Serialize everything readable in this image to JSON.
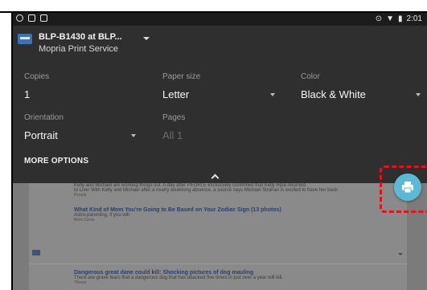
{
  "status_bar": {
    "time": "2:01",
    "left_icons": [
      "camera-icon",
      "notification-icon",
      "phone-icon"
    ],
    "right_icons": [
      "location-icon",
      "wifi-icon",
      "battery-icon"
    ]
  },
  "printer": {
    "name": "BLP-B1430  at BLP...",
    "service": "Mopria Print Service"
  },
  "options": {
    "copies": {
      "label": "Copies",
      "value": "1"
    },
    "paper_size": {
      "label": "Paper size",
      "value": "Letter"
    },
    "color": {
      "label": "Color",
      "value": "Black & White"
    },
    "orientation": {
      "label": "Orientation",
      "value": "Portrait"
    },
    "pages": {
      "label": "Pages",
      "value": "All 1"
    },
    "more_options": "MORE OPTIONS"
  },
  "background_articles": [
    {
      "text": "Kelly and Michael are working things out. A day after PEOPLE exclusively confirmed that Kelly Ripa returned",
      "text2": "to Live! With Kelly and Michael after a nearly weeklong absence, a source says Michael Strahan is excited to have her back",
      "source": "People"
    },
    {
      "title": "What Kind of Mom You're Going to Be Based on Your Zodiac Sign (13 photos)",
      "text": "Astro-parenting, if you will.",
      "source": "Mom Cents"
    },
    {
      "title": "Dangerous great dane could kill: Shocking pictures of dog mauling",
      "text": "There are grave fears that a dangerous dog that has attacked five times in just over a year will kill.",
      "source": "7News"
    }
  ],
  "fab": {
    "icon": "print-icon",
    "color": "#5bb9d8"
  },
  "highlight_color": "#e8101a"
}
